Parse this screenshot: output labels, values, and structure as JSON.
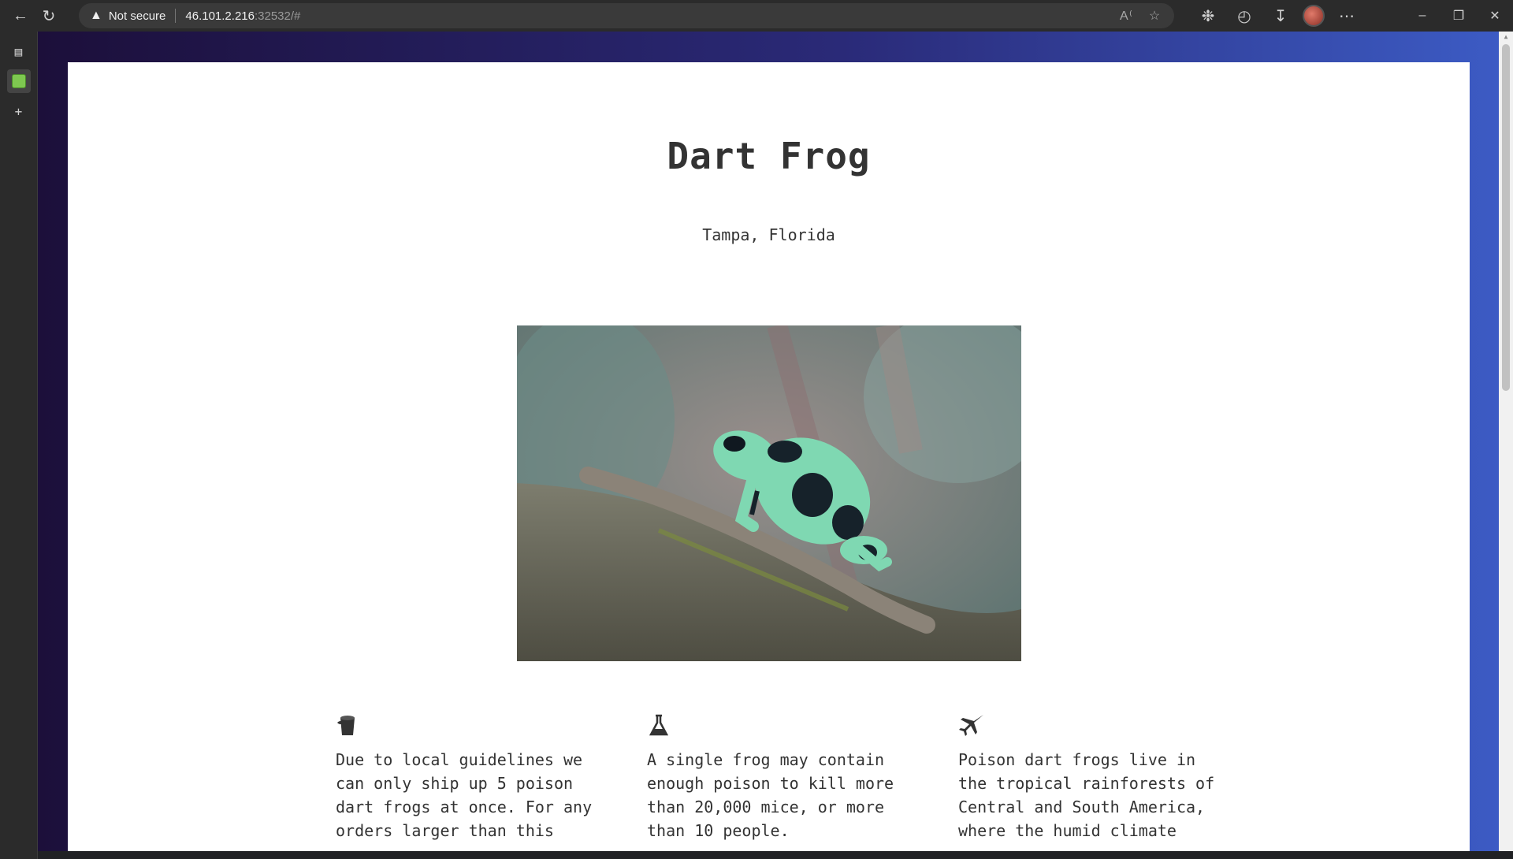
{
  "browser": {
    "security_label": "Not secure",
    "url_host": "46.101.2.216",
    "url_rest": ":32532/#"
  },
  "page": {
    "title": "Dart Frog",
    "location": "Tampa, Florida",
    "image_alt": "Green and black poison dart frog on a mossy branch"
  },
  "features": [
    {
      "icon": "bucket-icon",
      "text": "Due to local guidelines we can only ship up 5 poison dart frogs at once. For any orders larger than this"
    },
    {
      "icon": "flask-icon",
      "text": "A single frog may contain enough poison to kill more than 20,000 mice, or more than 10 people."
    },
    {
      "icon": "plane-icon",
      "text": "Poison dart frogs live in the tropical rainforests of Central and South America, where the humid climate"
    }
  ],
  "colors": {
    "bg_gradient_start": "#1c0f3a",
    "bg_gradient_end": "#3c5bc4",
    "text": "#333333"
  }
}
